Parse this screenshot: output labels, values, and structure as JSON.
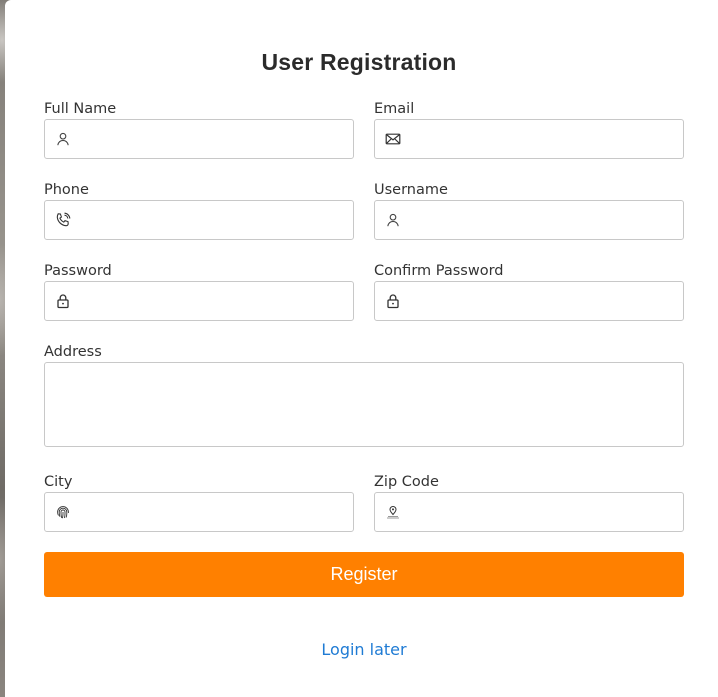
{
  "form": {
    "title": "User Registration",
    "fields": {
      "full_name": {
        "label": "Full Name",
        "value": "",
        "icon": "user-icon"
      },
      "email": {
        "label": "Email",
        "value": "",
        "icon": "envelope-icon"
      },
      "phone": {
        "label": "Phone",
        "value": "",
        "icon": "phone-icon"
      },
      "username": {
        "label": "Username",
        "value": "",
        "icon": "user-icon"
      },
      "password": {
        "label": "Password",
        "value": "",
        "icon": "lock-icon"
      },
      "confirm_password": {
        "label": "Confirm Password",
        "value": "",
        "icon": "lock-icon"
      },
      "address": {
        "label": "Address",
        "value": ""
      },
      "city": {
        "label": "City",
        "value": "",
        "icon": "fingerprint-icon"
      },
      "zip_code": {
        "label": "Zip Code",
        "value": "",
        "icon": "map-pin-icon"
      }
    },
    "register_label": "Register",
    "login_later_label": "Login later"
  },
  "colors": {
    "accent": "#ff8000",
    "link": "#1f7bd4",
    "border": "#c8c8c8",
    "text": "#333333"
  }
}
